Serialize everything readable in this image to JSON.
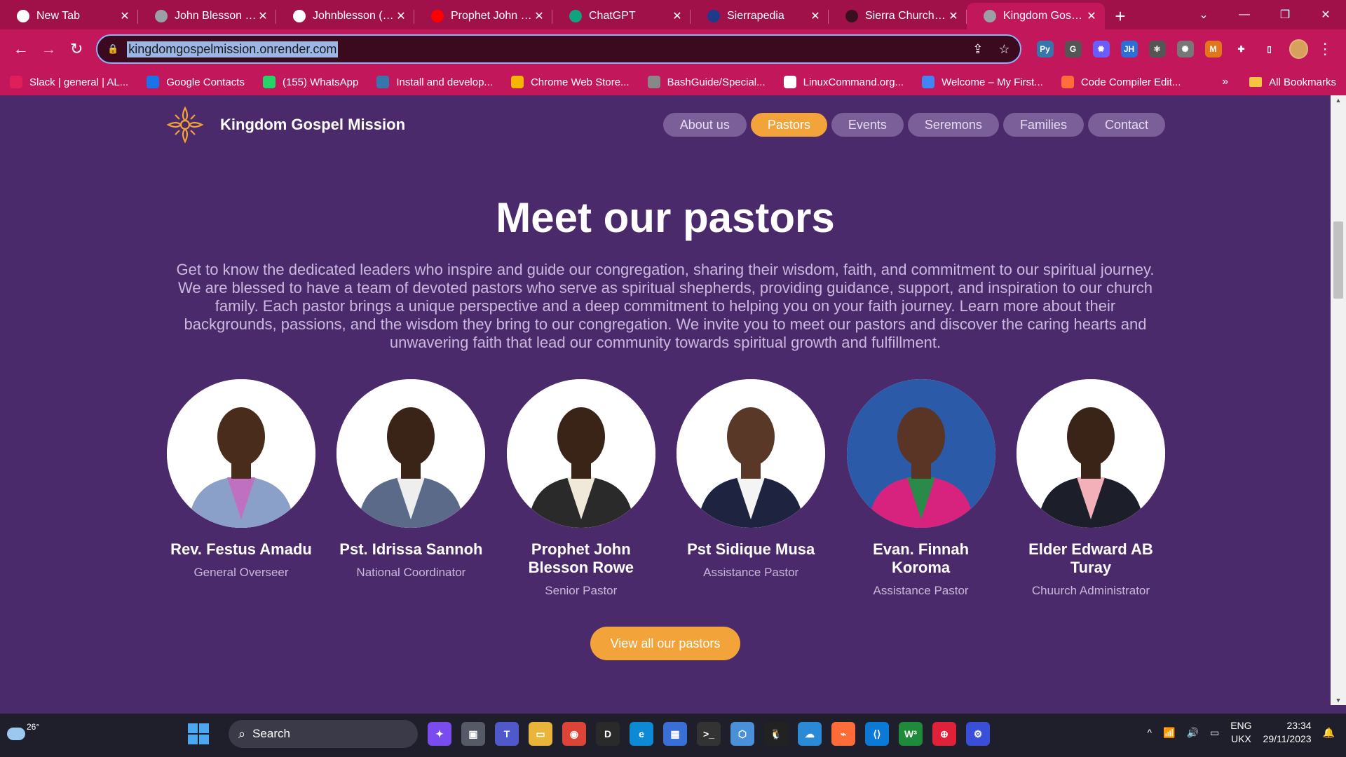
{
  "browser": {
    "tabs": [
      {
        "title": "New Tab",
        "favicon_color": "#ffffff",
        "active": false
      },
      {
        "title": "John Blesson | W",
        "favicon_color": "#9aa0a6",
        "active": false
      },
      {
        "title": "Johnblesson (Joh",
        "favicon_color": "#ffffff",
        "active": false
      },
      {
        "title": "Prophet John Ble",
        "favicon_color": "#ff0000",
        "active": false
      },
      {
        "title": "ChatGPT",
        "favicon_color": "#10a37f",
        "active": false
      },
      {
        "title": "Sierrapedia",
        "favicon_color": "#1e3a8a",
        "active": false
      },
      {
        "title": "Sierra Church Fir",
        "favicon_color": "#3a1020",
        "active": false
      },
      {
        "title": "Kingdom Gospel",
        "favicon_color": "#9aa0a6",
        "active": true
      }
    ],
    "new_tab_symbol": "+",
    "close_symbol": "✕",
    "window_controls": {
      "tab_search": "⌄",
      "minimize": "—",
      "restore": "❐",
      "close": "✕"
    },
    "nav": {
      "back": "←",
      "forward": "→",
      "reload": "↻"
    },
    "url": "kingdomgospelmission.onrender.com",
    "lock_icon": "🔒",
    "omnibox_icons": {
      "share": "⇪",
      "star": "☆"
    },
    "extensions": [
      {
        "name": "python-icon",
        "color": "#3776ab",
        "label": "Py"
      },
      {
        "name": "grammar-icon",
        "color": "#555555",
        "label": "G"
      },
      {
        "name": "gear-extension-icon",
        "color": "#6a5cff",
        "label": "✹"
      },
      {
        "name": "jh-icon",
        "color": "#2b6fd6",
        "label": "JH"
      },
      {
        "name": "react-icon",
        "color": "#555555",
        "label": "⚛"
      },
      {
        "name": "openai-icon",
        "color": "#777777",
        "label": "✺"
      },
      {
        "name": "metamask-icon",
        "color": "#e2761b",
        "label": "M"
      },
      {
        "name": "puzzle-icon",
        "color": "#c2185b",
        "label": "✚"
      },
      {
        "name": "sidepanel-icon",
        "color": "#c2185b",
        "label": "▯"
      }
    ],
    "more_menu": "⋮",
    "bookmarks": [
      {
        "label": "Slack | general | AL...",
        "color": "#e01e5a"
      },
      {
        "label": "Google Contacts",
        "color": "#1a73e8"
      },
      {
        "label": "(155) WhatsApp",
        "color": "#25d366"
      },
      {
        "label": "Install and develop...",
        "color": "#3776ab"
      },
      {
        "label": "Chrome Web Store...",
        "color": "#f4b400"
      },
      {
        "label": "BashGuide/Special...",
        "color": "#888888"
      },
      {
        "label": "LinuxCommand.org...",
        "color": "#ffffff"
      },
      {
        "label": "Welcome – My First...",
        "color": "#4285f4"
      },
      {
        "label": "Code Compiler Edit...",
        "color": "#ff6d3b"
      }
    ],
    "bookmarks_overflow": "»",
    "all_bookmarks": "All Bookmarks"
  },
  "site": {
    "name": "Kingdom Gospel Mission",
    "nav": [
      {
        "label": "About us",
        "active": false
      },
      {
        "label": "Pastors",
        "active": true
      },
      {
        "label": "Events",
        "active": false
      },
      {
        "label": "Seremons",
        "active": false
      },
      {
        "label": "Families",
        "active": false
      },
      {
        "label": "Contact",
        "active": false
      }
    ],
    "heading": "Meet our pastors",
    "intro": "Get to know the dedicated leaders who inspire and guide our congregation, sharing their wisdom, faith, and commitment to our spiritual journey. We are blessed to have a team of devoted pastors who serve as spiritual shepherds, providing guidance, support, and inspiration to our church family. Each pastor brings a unique perspective and a deep commitment to helping you on your faith journey. Learn more about their backgrounds, passions, and the wisdom they bring to our congregation. We invite you to meet our pastors and discover the caring hearts and unwavering faith that lead our community towards spiritual growth and fulfillment.",
    "pastors": [
      {
        "name": "Rev. Festus Amadu",
        "role": "General Overseer",
        "bg": "#ffffff",
        "suit": "#8aa0c8",
        "shirt": "#c070c0",
        "skin": "#4a2c1c"
      },
      {
        "name": "Pst. Idrissa Sannoh",
        "role": "National Coordinator",
        "bg": "#ffffff",
        "suit": "#5a6a88",
        "shirt": "#eeeeee",
        "skin": "#3a2418"
      },
      {
        "name": "Prophet John Blesson Rowe",
        "role": "Senior Pastor",
        "bg": "#ffffff",
        "suit": "#2a2a2a",
        "shirt": "#f0e8d8",
        "skin": "#3a2418"
      },
      {
        "name": "Pst Sidique Musa",
        "role": "Assistance Pastor",
        "bg": "#ffffff",
        "suit": "#1e2440",
        "shirt": "#f4f4f4",
        "skin": "#5a3828"
      },
      {
        "name": "Evan. Finnah Koroma",
        "role": "Assistance Pastor",
        "bg": "#2a5aa8",
        "suit": "#d8237e",
        "shirt": "#2a8a4a",
        "skin": "#5a3424"
      },
      {
        "name": "Elder Edward AB Turay",
        "role": "Chuurch Administrator",
        "bg": "#ffffff",
        "suit": "#1c1e2a",
        "shirt": "#f4b0b8",
        "skin": "#3a2418"
      }
    ],
    "cta": "View all our pastors",
    "colors": {
      "background": "#4b2a6b",
      "accent": "#f2a33a"
    }
  },
  "taskbar": {
    "temperature": "26°",
    "search_label": "Search",
    "apps": [
      {
        "name": "copilot-app-icon",
        "color": "#7a4cf0",
        "label": "✦"
      },
      {
        "name": "task-view-icon",
        "color": "#555a66",
        "label": "▣"
      },
      {
        "name": "teams-app-icon",
        "color": "#5059c9",
        "label": "T"
      },
      {
        "name": "file-explorer-icon",
        "color": "#e8b53a",
        "label": "▭"
      },
      {
        "name": "chrome-app-icon",
        "color": "#db4437",
        "label": "◉"
      },
      {
        "name": "dell-app-icon",
        "color": "#2a2a2a",
        "label": "D"
      },
      {
        "name": "edge-app-icon",
        "color": "#0c8ad6",
        "label": "e"
      },
      {
        "name": "store-app-icon",
        "color": "#3a6fd8",
        "label": "▦"
      },
      {
        "name": "terminal-app-icon",
        "color": "#333333",
        "label": ">_"
      },
      {
        "name": "box-app-icon",
        "color": "#4a90d9",
        "label": "⬡"
      },
      {
        "name": "penguin-app-icon",
        "color": "#222222",
        "label": "🐧"
      },
      {
        "name": "azure-app-icon",
        "color": "#2a8ad6",
        "label": "☁"
      },
      {
        "name": "postman-app-icon",
        "color": "#ff6c37",
        "label": "⌁"
      },
      {
        "name": "vscode-app-icon",
        "color": "#0a7ad6",
        "label": "⟨⟩"
      },
      {
        "name": "w3-app-icon",
        "color": "#1f8a3a",
        "label": "W³"
      },
      {
        "name": "twilio-app-icon",
        "color": "#e0213a",
        "label": "⊕"
      },
      {
        "name": "settings-app-icon",
        "color": "#3a4fd8",
        "label": "⚙"
      }
    ],
    "tray_chevron": "^",
    "language": "ENG",
    "layout": "UKX",
    "time": "23:34",
    "date": "29/11/2023"
  }
}
